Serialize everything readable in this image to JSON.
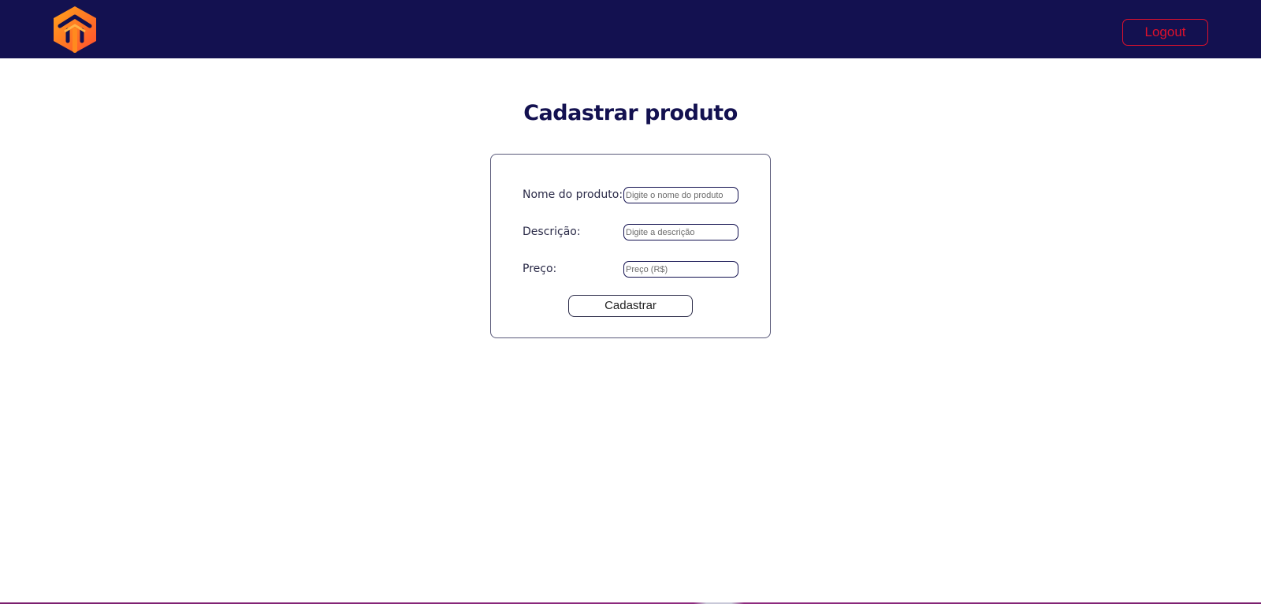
{
  "header": {
    "logo_icon": "house-cube-logo-icon",
    "logout_label": "Logout",
    "colors": {
      "background": "#131150",
      "logout": "#e0112b",
      "logo_gradient_start": "#ffa31a",
      "logo_gradient_end": "#ff5a2a"
    }
  },
  "main": {
    "title": "Cadastrar produto",
    "form": {
      "fields": [
        {
          "label": "Nome do produto:",
          "placeholder": "Digite o nome do produto",
          "value": ""
        },
        {
          "label": "Descrição:",
          "placeholder": "Digite a descrição",
          "value": ""
        },
        {
          "label": "Preço:",
          "placeholder": "Preço (R$)",
          "value": ""
        }
      ],
      "submit_label": "Cadastrar"
    },
    "colors": {
      "title": "#131150",
      "border": "#5a5a7a"
    }
  }
}
